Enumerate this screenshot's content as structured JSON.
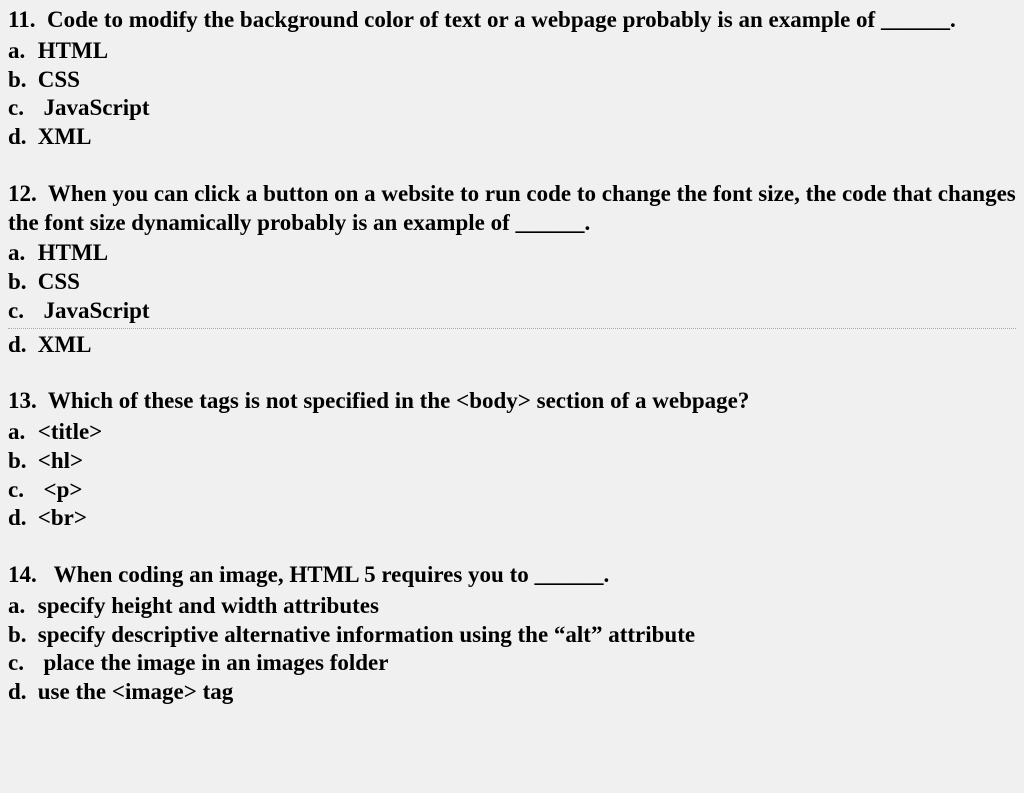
{
  "questions": [
    {
      "number": "11.",
      "text": "Code to modify the background color of text or a webpage probably is an example of ______.",
      "options": {
        "a": "HTML",
        "b": "CSS",
        "c": "JavaScript",
        "d": "XML"
      }
    },
    {
      "number": "12.",
      "text": "When you can click a button on a website to run code to change the font size, the code that changes the font size dynamically probably is an example of ______.",
      "options": {
        "a": "HTML",
        "b": "CSS",
        "c": "JavaScript",
        "d": "XML"
      }
    },
    {
      "number": "13.",
      "text": "Which of these tags is not specified in the <body> section of a webpage?",
      "options": {
        "a": "<title>",
        "b": "<hl>",
        "c": "<p>",
        "d": "<br>"
      }
    },
    {
      "number": "14.",
      "text": "When coding an image, HTML 5 requires you to ______.",
      "options": {
        "a": "specify height and width attributes",
        "b": "specify descriptive alternative information using the “alt” attribute",
        "c": "place the image in an images folder",
        "d": "use the <image> tag"
      }
    }
  ],
  "labels": {
    "a": "a.",
    "b": "b.",
    "c": "c.",
    "d": "d."
  }
}
